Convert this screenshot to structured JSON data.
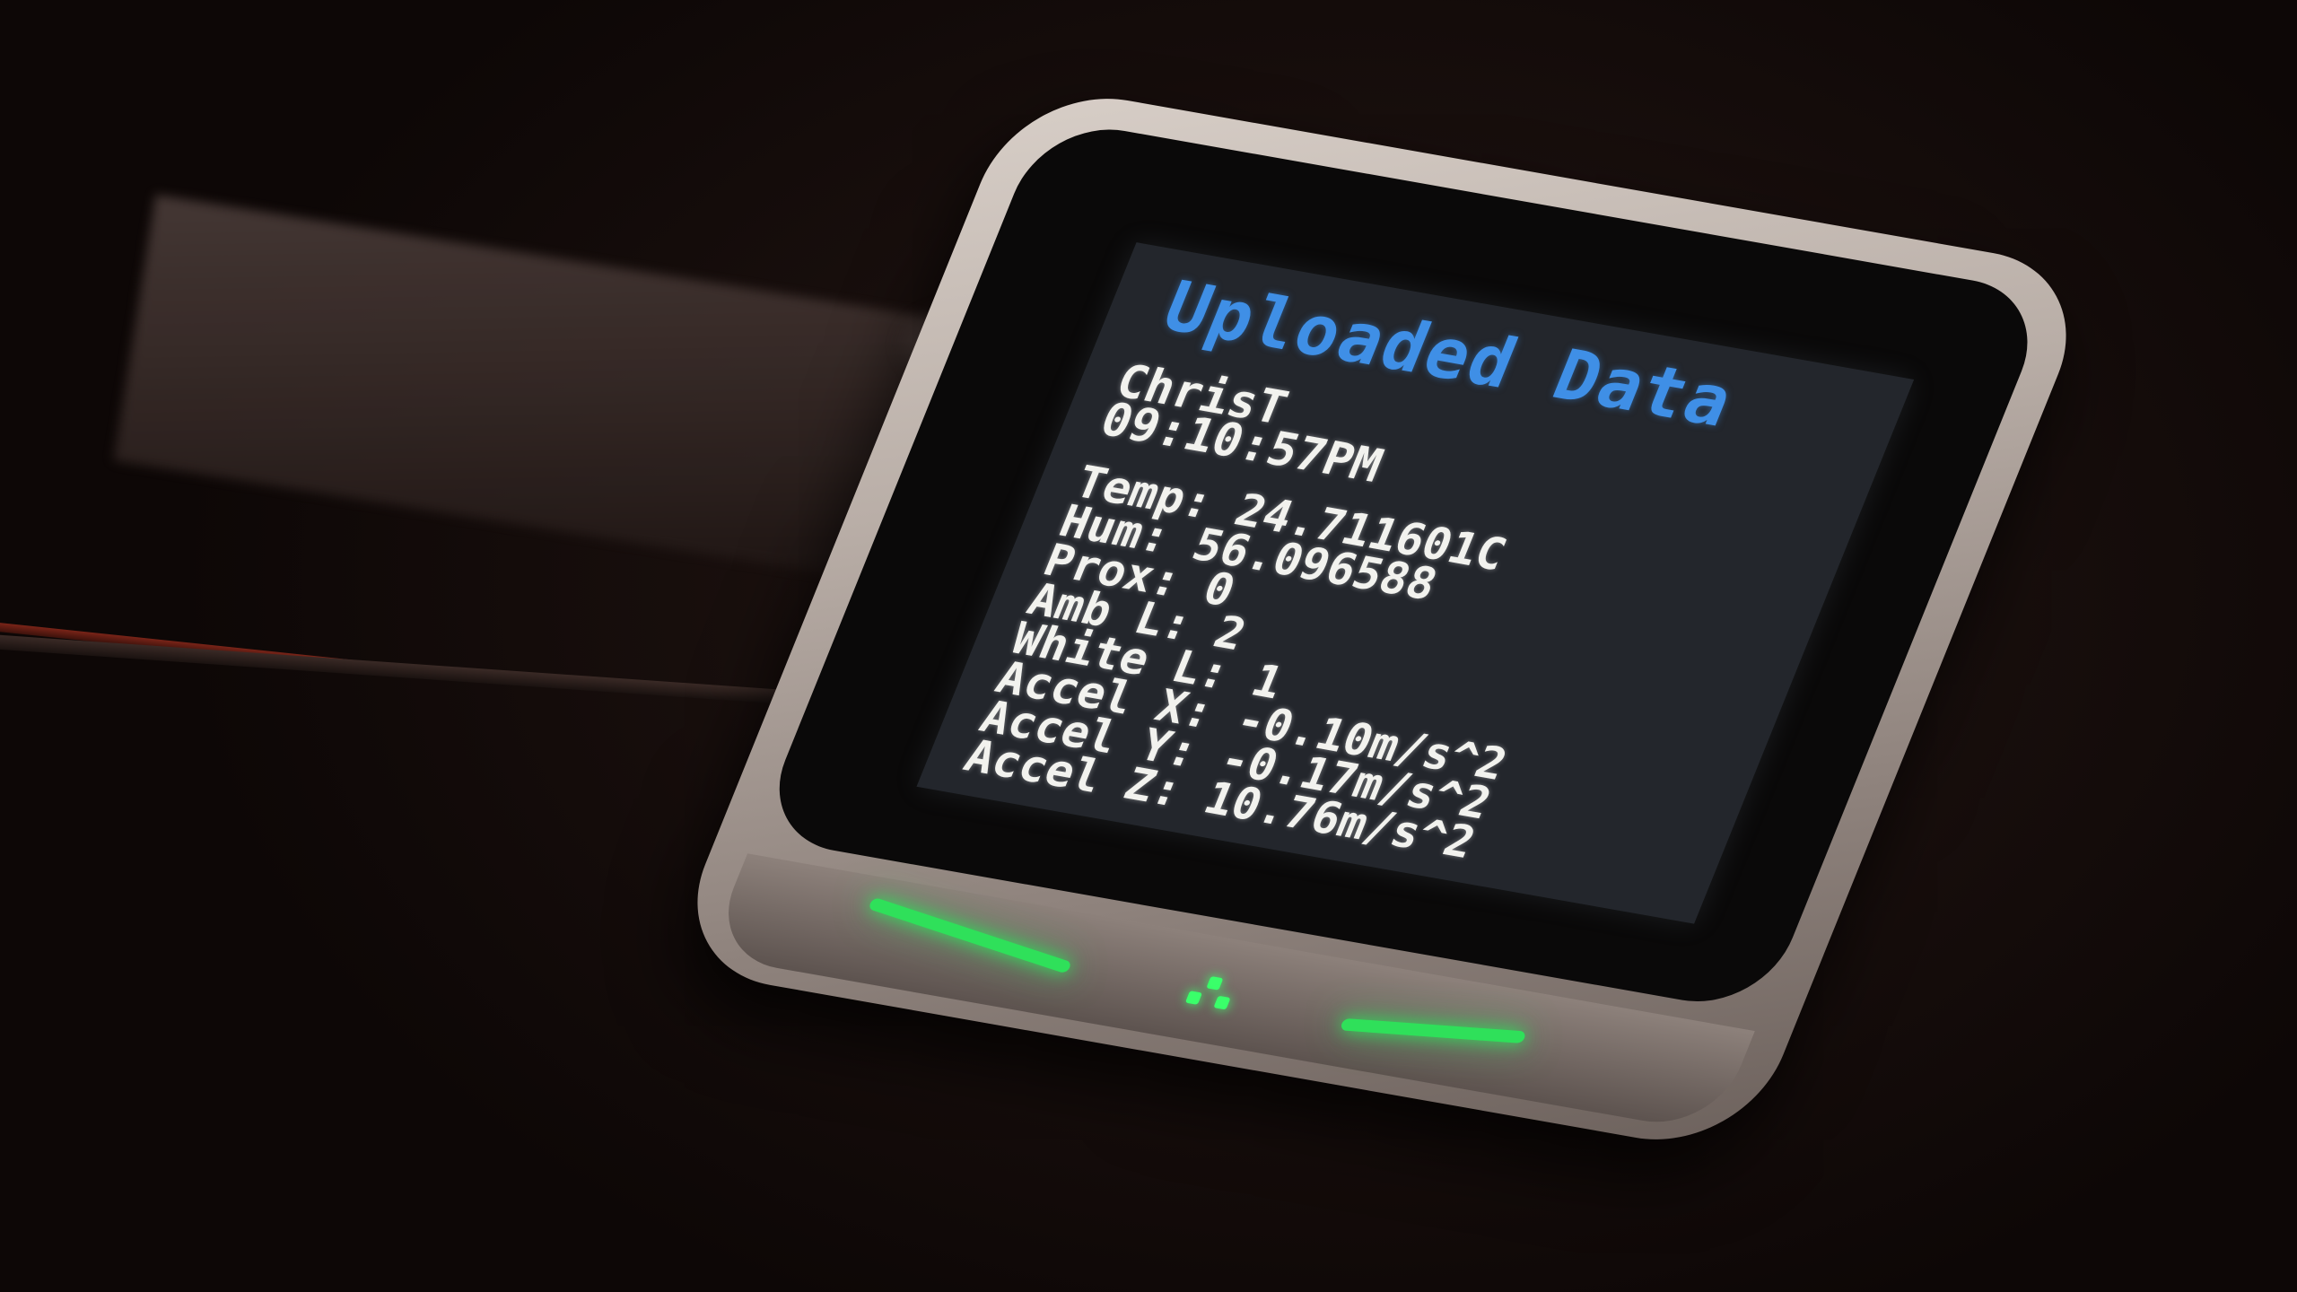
{
  "screen": {
    "title": "Uploaded Data",
    "user": "ChrisT",
    "time": "09:10:57PM",
    "readings": [
      "Temp: 24.711601C",
      "Hum: 56.096588",
      "Prox: 0",
      "Amb L: 2",
      "White L: 1",
      "Accel X: -0.10m/s^2",
      "Accel Y: -0.17m/s^2",
      "Accel Z: 10.76m/s^2"
    ],
    "colors": {
      "title": "#3f8fe6",
      "text": "#f2f2ee",
      "background": "#23262c",
      "led": "#2fe05a"
    }
  }
}
